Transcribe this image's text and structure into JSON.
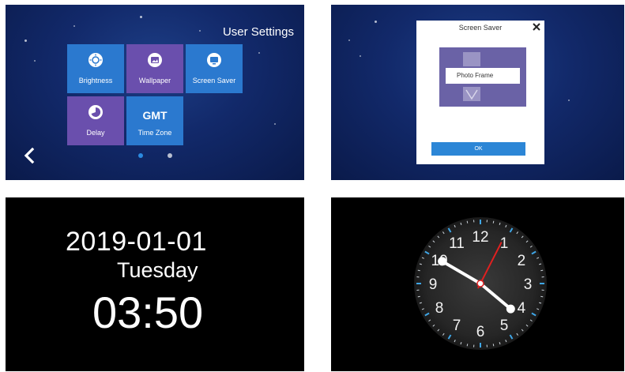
{
  "user_settings": {
    "title": "User Settings",
    "tiles": [
      {
        "label": "Brightness",
        "icon": "brightness-icon",
        "color": "#2b79cf"
      },
      {
        "label": "Wallpaper",
        "icon": "wallpaper-icon",
        "color": "#6a4fad"
      },
      {
        "label": "Screen Saver",
        "icon": "screen-saver-icon",
        "color": "#2b79cf"
      },
      {
        "label": "Delay",
        "icon": "delay-icon",
        "color": "#6a4fad"
      },
      {
        "label": "Time Zone",
        "icon_text": "GMT",
        "color": "#2b79cf"
      }
    ],
    "page_indicator": {
      "total": 2,
      "current": 1
    },
    "back_icon": "chevron-left-icon"
  },
  "screen_saver_dialog": {
    "title": "Screen Saver",
    "selected_option": "Photo Frame",
    "ok_label": "OK",
    "close_icon": "close-icon"
  },
  "digital_clock": {
    "date": "2019-01-01",
    "weekday": "Tuesday",
    "time": "03:50"
  },
  "analog_clock": {
    "numbers": [
      "12",
      "1",
      "2",
      "3",
      "4",
      "5",
      "6",
      "7",
      "8",
      "9",
      "10",
      "11"
    ],
    "hour": 3,
    "minute": 50,
    "second": 2,
    "tick_color": "#3fa6e6",
    "second_hand_color": "#e02020"
  }
}
